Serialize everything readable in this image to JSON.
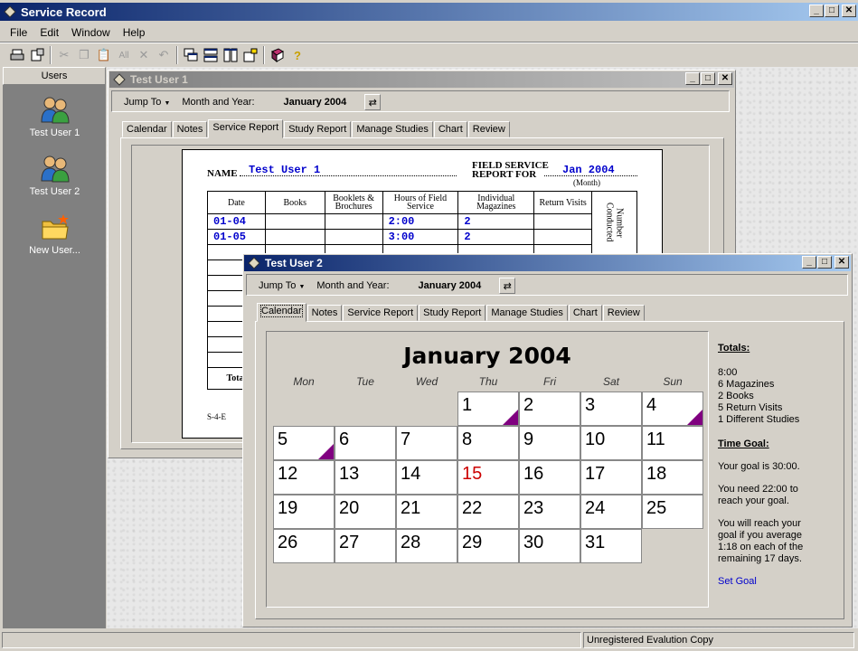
{
  "app": {
    "title": "Service Record",
    "menu": [
      "File",
      "Edit",
      "Window",
      "Help"
    ],
    "toolbar_icons": [
      "print-icon",
      "print-setup-icon",
      "cut-icon",
      "copy-icon",
      "paste-icon",
      "select-all-icon",
      "delete-icon",
      "undo-icon",
      "cascade-icon",
      "tile-horizontal-icon",
      "tile-vertical-icon",
      "arrange-icons-icon",
      "book-icon",
      "help-icon"
    ],
    "status": "Unregistered Evalution Copy"
  },
  "sidebar": {
    "header": "Users",
    "items": [
      {
        "label": "Test User 1",
        "icon": "users-icon"
      },
      {
        "label": "Test User 2",
        "icon": "users-icon"
      },
      {
        "label": "New User...",
        "icon": "new-folder-icon"
      }
    ]
  },
  "win1": {
    "title": "Test User 1",
    "jump_to": "Jump To",
    "month_year_label": "Month and Year:",
    "month_year_value": "January 2004",
    "tabs": [
      "Calendar",
      "Notes",
      "Service Report",
      "Study Report",
      "Manage Studies",
      "Chart",
      "Review"
    ],
    "active_tab": "Service Report",
    "report": {
      "name_label": "NAME",
      "name_value": "Test User 1",
      "report_for_label_1": "FIELD SERVICE",
      "report_for_label_2": "REPORT FOR",
      "report_for_value": "Jan 2004",
      "month_hint": "(Month)",
      "headers": [
        "Date",
        "Books",
        "Booklets & Brochures",
        "Hours of Field Service",
        "Individual Magazines",
        "Return Visits"
      ],
      "side_header": "Number Conducted",
      "rows": [
        {
          "date": "01-04",
          "books": "",
          "booklets": "",
          "hours": "2:00",
          "magazines": "2",
          "visits": ""
        },
        {
          "date": "01-05",
          "books": "",
          "booklets": "",
          "hours": "3:00",
          "magazines": "2",
          "visits": ""
        }
      ],
      "total_label": "Total",
      "form_code": "S-4-E"
    }
  },
  "win2": {
    "title": "Test User 2",
    "jump_to": "Jump To",
    "month_year_label": "Month and Year:",
    "month_year_value": "January 2004",
    "tabs": [
      "Calendar",
      "Notes",
      "Service Report",
      "Study Report",
      "Manage Studies",
      "Chart",
      "Review"
    ],
    "active_tab": "Calendar",
    "calendar": {
      "heading": "January 2004",
      "days_of_week": [
        "Mon",
        "Tue",
        "Wed",
        "Thu",
        "Fri",
        "Sat",
        "Sun"
      ],
      "first_day_col": 3,
      "days": 31,
      "today": 15,
      "today_color": "#cc0000",
      "marked_days": [
        1,
        4,
        5
      ],
      "marker_color": "#800080"
    },
    "totals": {
      "heading": "Totals:",
      "lines": [
        "8:00",
        "6 Magazines",
        "2 Books",
        "5 Return Visits",
        "1 Different Studies"
      ]
    },
    "goal": {
      "heading": "Time Goal:",
      "line1": "Your goal is 30:00.",
      "line2a": "You need 22:00 to",
      "line2b": "reach your goal.",
      "line3a": "You will reach your",
      "line3b": "goal if you average",
      "line3c": "1:18 on each of the",
      "line3d": "remaining 17 days.",
      "link": "Set Goal"
    }
  }
}
